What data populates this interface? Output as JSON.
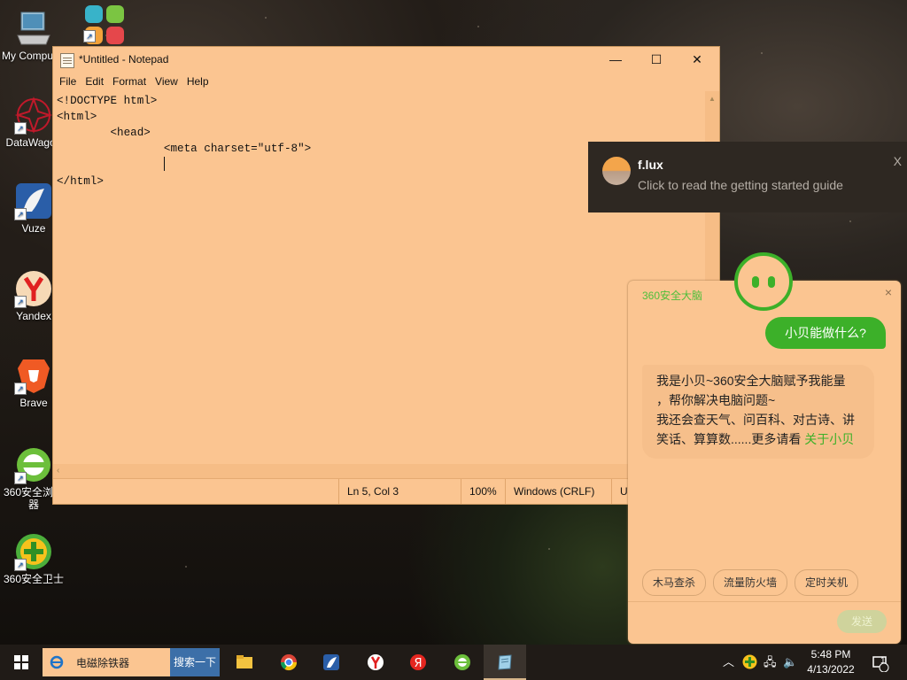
{
  "desktop": {
    "icons": [
      {
        "label": "My Computer"
      },
      {
        "label": ""
      },
      {
        "label": "DataWagon"
      },
      {
        "label": "Vuze"
      },
      {
        "label": "Yandex"
      },
      {
        "label": "Brave"
      },
      {
        "label": "360安全浏览器"
      },
      {
        "label": "360安全卫士"
      }
    ]
  },
  "notepad": {
    "title": "*Untitled - Notepad",
    "menu": [
      "File",
      "Edit",
      "Format",
      "View",
      "Help"
    ],
    "content_lines": [
      "<!DOCTYPE html>",
      "<html>",
      "        <head>",
      "                <meta charset=\"utf-8\">",
      "                ",
      "</html>"
    ],
    "status": {
      "position": "Ln 5, Col 3",
      "zoom": "100%",
      "line_ending": "Windows (CRLF)",
      "encoding": "UT"
    }
  },
  "toast": {
    "app": "f.lux",
    "message": "Click to read the getting started guide",
    "close": "X"
  },
  "assistant": {
    "brand": "360安全大脑",
    "close": "×",
    "user_message": "小贝能做什么?",
    "reply_lines": [
      "我是小贝~360安全大脑赋予我能量",
      "，帮你解决电脑问题~",
      "我还会查天气、问百科、对古诗、讲",
      "笑话、算算数......更多请看 "
    ],
    "reply_link": "关于小贝",
    "chips": [
      "木马查杀",
      "流量防火墙",
      "定时关机"
    ],
    "send": "发送"
  },
  "taskbar": {
    "search_text": "电磁除铁器",
    "search_button": "搜索一下",
    "clock_time": "5:48 PM",
    "clock_date": "4/13/2022",
    "notification_count": "1"
  },
  "colors": {
    "notepad_bg": "#fbc591",
    "accent_green": "#3cb029",
    "taskbar": "#201b17"
  }
}
